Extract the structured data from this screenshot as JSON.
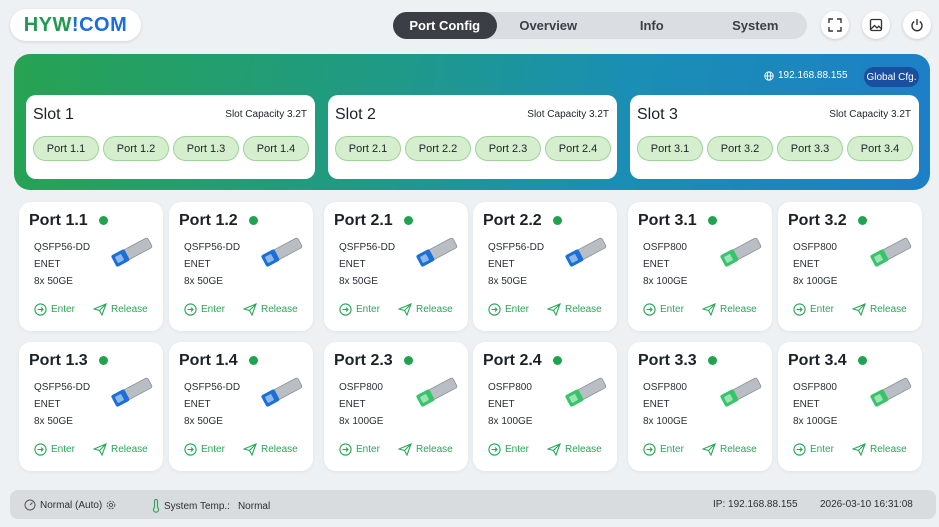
{
  "brand": {
    "part1": "HYW",
    "part2": "!",
    "part3": "COM"
  },
  "tabs": [
    "Port Config",
    "Overview",
    "Info",
    "System"
  ],
  "top_icons": [
    "fullscreen-icon",
    "image-icon",
    "power-icon"
  ],
  "banner": {
    "ip": "192.168.88.155",
    "global_button": "Global Cfg."
  },
  "slots": [
    {
      "title": "Slot 1",
      "capacity": "Slot Capacity 3.2T",
      "ports": [
        "Port 1.1",
        "Port 1.2",
        "Port 1.3",
        "Port 1.4"
      ]
    },
    {
      "title": "Slot 2",
      "capacity": "Slot Capacity 3.2T",
      "ports": [
        "Port 2.1",
        "Port 2.2",
        "Port 2.3",
        "Port 2.4"
      ]
    },
    {
      "title": "Slot 3",
      "capacity": "Slot Capacity 3.2T",
      "ports": [
        "Port 3.1",
        "Port 3.2",
        "Port 3.3",
        "Port 3.4"
      ]
    }
  ],
  "cards": [
    {
      "title": "Port 1.1",
      "module": "QSFP56-DD",
      "mode": "ENET",
      "speed": "8x 50GE",
      "module_color": "#1b6fd6"
    },
    {
      "title": "Port 1.2",
      "module": "QSFP56-DD",
      "mode": "ENET",
      "speed": "8x 50GE",
      "module_color": "#1b6fd6"
    },
    {
      "title": "Port 2.1",
      "module": "QSFP56-DD",
      "mode": "ENET",
      "speed": "8x 50GE",
      "module_color": "#1b6fd6"
    },
    {
      "title": "Port 2.2",
      "module": "QSFP56-DD",
      "mode": "ENET",
      "speed": "8x 50GE",
      "module_color": "#1b6fd6"
    },
    {
      "title": "Port 3.1",
      "module": "OSFP800",
      "mode": "ENET",
      "speed": "8x 100GE",
      "module_color": "#37c46a"
    },
    {
      "title": "Port 3.2",
      "module": "OSFP800",
      "mode": "ENET",
      "speed": "8x 100GE",
      "module_color": "#37c46a"
    },
    {
      "title": "Port 1.3",
      "module": "QSFP56-DD",
      "mode": "ENET",
      "speed": "8x 50GE",
      "module_color": "#1b6fd6"
    },
    {
      "title": "Port 1.4",
      "module": "QSFP56-DD",
      "mode": "ENET",
      "speed": "8x 50GE",
      "module_color": "#1b6fd6"
    },
    {
      "title": "Port 2.3",
      "module": "OSFP800",
      "mode": "ENET",
      "speed": "8x 100GE",
      "module_color": "#37c46a"
    },
    {
      "title": "Port 2.4",
      "module": "OSFP800",
      "mode": "ENET",
      "speed": "8x 100GE",
      "module_color": "#37c46a"
    },
    {
      "title": "Port 3.3",
      "module": "OSFP800",
      "mode": "ENET",
      "speed": "8x 100GE",
      "module_color": "#37c46a"
    },
    {
      "title": "Port 3.4",
      "module": "OSFP800",
      "mode": "ENET",
      "speed": "8x 100GE",
      "module_color": "#37c46a"
    }
  ],
  "card_actions": {
    "enter": "Enter",
    "release": "Release"
  },
  "status": {
    "mode": "Normal (Auto)",
    "temp_label": "System Temp.:",
    "temp_value": "Normal",
    "ip": "IP: 192.168.88.155",
    "datetime": "2026-03-10 16:31:08"
  },
  "colors": {
    "accent_green": "#1fa34e",
    "brand_blue": "#1b6fd6",
    "active_tab": "#3b3f45"
  }
}
